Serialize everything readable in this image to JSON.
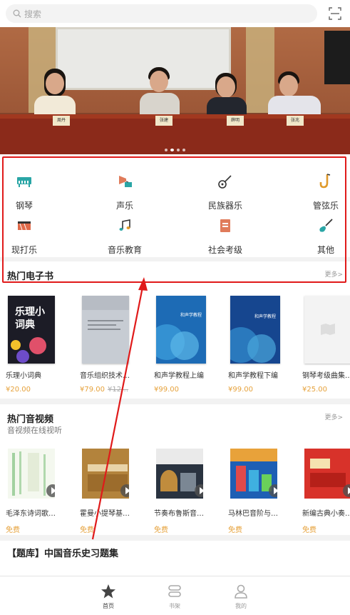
{
  "search": {
    "placeholder": "搜索"
  },
  "banner": {
    "nameplates": [
      "周丹",
      "张建",
      "薛明",
      "张兆"
    ],
    "dots": 4,
    "active_dot": 1
  },
  "categories": [
    {
      "label": "钢琴",
      "icon": "piano-icon"
    },
    {
      "label": "声乐",
      "icon": "gramophone-icon"
    },
    {
      "label": "民族器乐",
      "icon": "pipa-icon"
    },
    {
      "label": "管弦乐",
      "icon": "saxophone-icon"
    },
    {
      "label": "现打乐",
      "icon": "drum-icon"
    },
    {
      "label": "音乐教育",
      "icon": "music-note-icon"
    },
    {
      "label": "社会考级",
      "icon": "certificate-icon"
    },
    {
      "label": "其他",
      "icon": "guitar-icon"
    }
  ],
  "ebooks": {
    "title": "热门电子书",
    "more": "更多>",
    "items": [
      {
        "name": "乐理小词典",
        "price": "¥20.00",
        "old_price": "",
        "cover_title": "乐理小词典"
      },
      {
        "name": "音乐组织技术…",
        "price": "¥79.00",
        "old_price": "¥12…",
        "cover_title": ""
      },
      {
        "name": "和声学教程上编",
        "price": "¥99.00",
        "old_price": "",
        "cover_title": "和声学教程"
      },
      {
        "name": "和声学教程下编",
        "price": "¥99.00",
        "old_price": "",
        "cover_title": "和声学教程"
      },
      {
        "name": "钢琴考级曲集…",
        "price": "¥25.00",
        "old_price": "",
        "cover_title": ""
      }
    ]
  },
  "videos": {
    "title": "热门音视频",
    "subtitle": "音视频在线视听",
    "more": "更多>",
    "items": [
      {
        "name": "毛泽东诗词歌…",
        "badge": "免费"
      },
      {
        "name": "霍曼小提琴基…",
        "badge": "免费"
      },
      {
        "name": "节奏布鲁斯音…",
        "badge": "免费"
      },
      {
        "name": "马林巴音阶与…",
        "badge": "免费"
      },
      {
        "name": "新编古典小奏…",
        "badge": "免费"
      }
    ]
  },
  "quiz": {
    "title": "【题库】中国音乐史习题集"
  },
  "tabbar": {
    "items": [
      {
        "label": "首页",
        "icon": "star-icon",
        "active": true
      },
      {
        "label": "书架",
        "icon": "bookshelf-icon",
        "active": false
      },
      {
        "label": "我的",
        "icon": "user-icon",
        "active": false
      }
    ]
  },
  "colors": {
    "accent_price": "#e6a23c",
    "highlight": "#e01a1a"
  }
}
